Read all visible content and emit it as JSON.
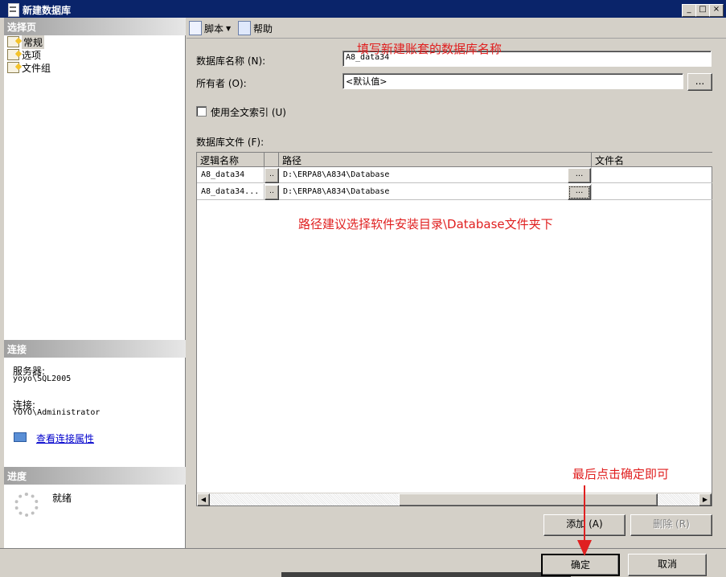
{
  "window": {
    "title": "新建数据库",
    "min_label": "_",
    "max_label": "□",
    "close_label": "×"
  },
  "sidebar": {
    "select_page_header": "选择页",
    "pages": [
      {
        "label": "常规",
        "selected": true
      },
      {
        "label": "选项",
        "selected": false
      },
      {
        "label": "文件组",
        "selected": false
      }
    ],
    "connection_header": "连接",
    "server_label": "服务器:",
    "server_value": "yoyo\\SQL2005",
    "connection_label": "连接:",
    "connection_value": "YOYO\\Administrator",
    "view_props_link": "查看连接属性",
    "progress_header": "进度",
    "progress_status": "就绪"
  },
  "toolbar": {
    "script_label": "脚本",
    "help_label": "帮助"
  },
  "form": {
    "db_name_label": "数据库名称 (N):",
    "db_name_value": "A8_data34",
    "owner_label": "所有者 (O):",
    "owner_value": "<默认值>",
    "browse_label": "...",
    "fulltext_label": "使用全文索引 (U)",
    "files_label": "数据库文件 (F):"
  },
  "files_table": {
    "columns": [
      "逻辑名称",
      "路径",
      "文件名"
    ],
    "rows": [
      {
        "logical": "A8_data34",
        "path": "D:\\ERPA8\\A834\\Database",
        "filename": ""
      },
      {
        "logical": "A8_data34...",
        "path": "D:\\ERPA8\\A834\\Database",
        "filename": ""
      }
    ],
    "ellipsis": "...",
    "small_ellipsis": ".."
  },
  "buttons": {
    "add": "添加 (A)",
    "remove": "删除 (R)",
    "ok": "确定",
    "cancel": "取消"
  },
  "annotations": {
    "name_hint": "填写新建账套的数据库名称",
    "path_hint": "路径建议选择软件安装目录\\Database文件夹下",
    "ok_hint": "最后点击确定即可"
  },
  "colors": {
    "annotation": "#e02020",
    "titlebar": "#0a246a",
    "link": "#0000cc"
  }
}
